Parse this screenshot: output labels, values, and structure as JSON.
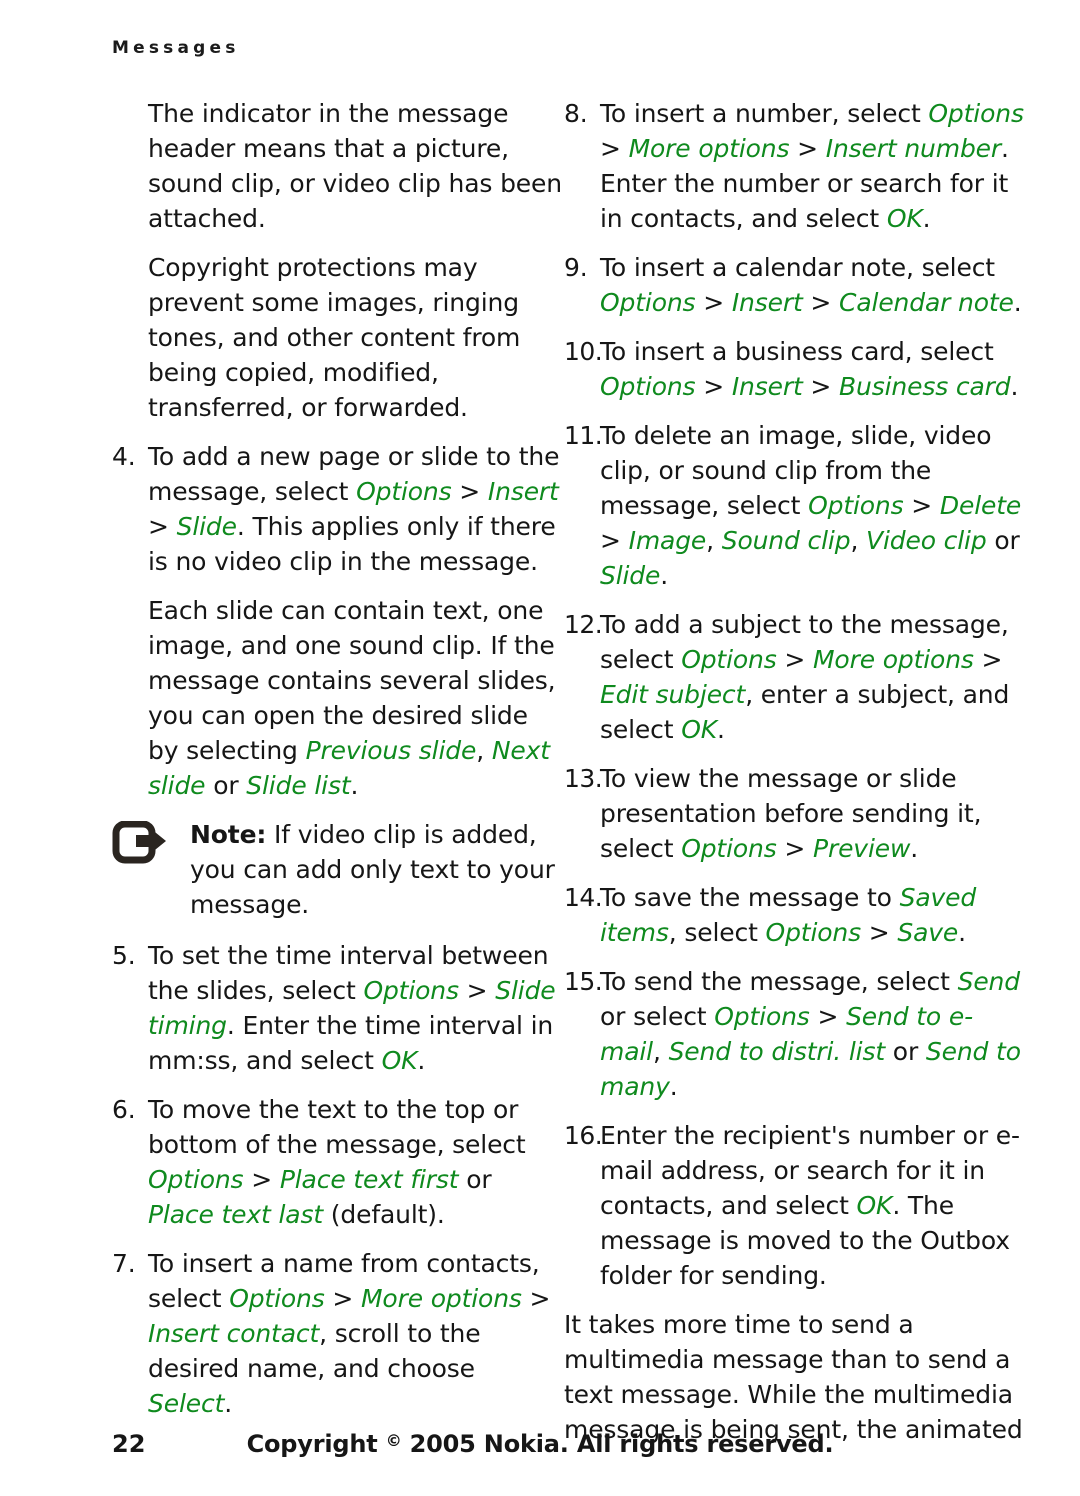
{
  "running_head": "Messages",
  "green_accent": "#0f8a1e",
  "text_color": "#161616",
  "left_column": [
    {
      "kind": "paragraph",
      "name": "paragraph-indicator",
      "runs": [
        {
          "t": "The indicator in the message header means that a picture, sound clip, or video clip has been attached.",
          "s": "plain"
        }
      ]
    },
    {
      "kind": "paragraph",
      "name": "paragraph-copyright-protections",
      "runs": [
        {
          "t": "Copyright protections may prevent some images, ringing tones, and other content from being copied, modified, transferred, or forwarded.",
          "s": "plain"
        }
      ]
    },
    {
      "kind": "item",
      "name": "step-4",
      "number": "4.",
      "runs": [
        {
          "t": "To add a new page or slide to the message, select ",
          "s": "plain"
        },
        {
          "t": "Options",
          "s": "ui"
        },
        {
          "t": " > ",
          "s": "sep"
        },
        {
          "t": "Insert",
          "s": "ui"
        },
        {
          "t": " > ",
          "s": "sep"
        },
        {
          "t": "Slide",
          "s": "ui"
        },
        {
          "t": ". This applies only if there is no video clip in the message.",
          "s": "plain"
        }
      ]
    },
    {
      "kind": "paragraph",
      "name": "paragraph-each-slide",
      "runs": [
        {
          "t": "Each slide can contain text, one image, and one sound clip. If the message contains several slides, you can open the desired slide by selecting ",
          "s": "plain"
        },
        {
          "t": "Previous slide",
          "s": "ui"
        },
        {
          "t": ", ",
          "s": "sep"
        },
        {
          "t": "Next slide",
          "s": "ui"
        },
        {
          "t": " or ",
          "s": "plain"
        },
        {
          "t": "Slide list",
          "s": "ui"
        },
        {
          "t": ".",
          "s": "plain"
        }
      ]
    },
    {
      "kind": "note",
      "name": "note-video-clip",
      "icon": "note-arrow-icon",
      "label": "Note:",
      "runs": [
        {
          "t": " If video clip is added, you can add only text to your message.",
          "s": "plain"
        }
      ]
    },
    {
      "kind": "item",
      "name": "step-5",
      "number": "5.",
      "runs": [
        {
          "t": "To set the time interval between the slides, select ",
          "s": "plain"
        },
        {
          "t": "Options",
          "s": "ui"
        },
        {
          "t": " > ",
          "s": "sep"
        },
        {
          "t": "Slide timing",
          "s": "ui"
        },
        {
          "t": ". Enter the time interval in mm:ss, and select ",
          "s": "plain"
        },
        {
          "t": "OK",
          "s": "ui"
        },
        {
          "t": ".",
          "s": "plain"
        }
      ]
    },
    {
      "kind": "item",
      "name": "step-6",
      "number": "6.",
      "runs": [
        {
          "t": "To move the text to the top or bottom of the message, select ",
          "s": "plain"
        },
        {
          "t": "Options",
          "s": "ui"
        },
        {
          "t": " > ",
          "s": "sep"
        },
        {
          "t": "Place text first",
          "s": "ui"
        },
        {
          "t": " or ",
          "s": "plain"
        },
        {
          "t": "Place text last",
          "s": "ui"
        },
        {
          "t": " (default).",
          "s": "plain"
        }
      ]
    },
    {
      "kind": "item",
      "name": "step-7",
      "number": "7.",
      "runs": [
        {
          "t": "To insert a name from contacts, select ",
          "s": "plain"
        },
        {
          "t": "Options",
          "s": "ui"
        },
        {
          "t": " > ",
          "s": "sep"
        },
        {
          "t": "More options",
          "s": "ui"
        },
        {
          "t": " > ",
          "s": "sep"
        },
        {
          "t": "Insert contact",
          "s": "ui"
        },
        {
          "t": ", scroll to the desired name, and choose ",
          "s": "plain"
        },
        {
          "t": "Select",
          "s": "ui"
        },
        {
          "t": ".",
          "s": "plain"
        }
      ]
    }
  ],
  "right_column": [
    {
      "kind": "item",
      "name": "step-8",
      "number": "8.",
      "runs": [
        {
          "t": "To insert a number, select ",
          "s": "plain"
        },
        {
          "t": "Options",
          "s": "ui"
        },
        {
          "t": " > ",
          "s": "sep"
        },
        {
          "t": "More options",
          "s": "ui"
        },
        {
          "t": " > ",
          "s": "sep"
        },
        {
          "t": "Insert number",
          "s": "ui"
        },
        {
          "t": ". Enter the number or search for it in contacts, and select ",
          "s": "plain"
        },
        {
          "t": "OK",
          "s": "ui"
        },
        {
          "t": ".",
          "s": "plain"
        }
      ]
    },
    {
      "kind": "item",
      "name": "step-9",
      "number": "9.",
      "runs": [
        {
          "t": "To insert a calendar note, select ",
          "s": "plain"
        },
        {
          "t": "Options",
          "s": "ui"
        },
        {
          "t": " > ",
          "s": "sep"
        },
        {
          "t": "Insert",
          "s": "ui"
        },
        {
          "t": " > ",
          "s": "sep"
        },
        {
          "t": "Calendar note",
          "s": "ui"
        },
        {
          "t": ".",
          "s": "plain"
        }
      ]
    },
    {
      "kind": "item",
      "name": "step-10",
      "number": "10.",
      "wide": true,
      "runs": [
        {
          "t": "To insert a business card, select ",
          "s": "plain"
        },
        {
          "t": "Options",
          "s": "ui"
        },
        {
          "t": " > ",
          "s": "sep"
        },
        {
          "t": "Insert",
          "s": "ui"
        },
        {
          "t": " > ",
          "s": "sep"
        },
        {
          "t": "Business card",
          "s": "ui"
        },
        {
          "t": ".",
          "s": "plain"
        }
      ]
    },
    {
      "kind": "item",
      "name": "step-11",
      "number": "11.",
      "wide": true,
      "runs": [
        {
          "t": "To delete an image, slide, video clip, or sound clip from the message, select ",
          "s": "plain"
        },
        {
          "t": "Options",
          "s": "ui"
        },
        {
          "t": " > ",
          "s": "sep"
        },
        {
          "t": "Delete",
          "s": "ui"
        },
        {
          "t": " > ",
          "s": "sep"
        },
        {
          "t": "Image",
          "s": "ui"
        },
        {
          "t": ", ",
          "s": "sep"
        },
        {
          "t": "Sound clip",
          "s": "ui"
        },
        {
          "t": ", ",
          "s": "sep"
        },
        {
          "t": "Video clip",
          "s": "ui"
        },
        {
          "t": " or ",
          "s": "plain"
        },
        {
          "t": "Slide",
          "s": "ui"
        },
        {
          "t": ".",
          "s": "plain"
        }
      ]
    },
    {
      "kind": "item",
      "name": "step-12",
      "number": "12.",
      "wide": true,
      "runs": [
        {
          "t": "To add a subject to the message, select ",
          "s": "plain"
        },
        {
          "t": "Options",
          "s": "ui"
        },
        {
          "t": " > ",
          "s": "sep"
        },
        {
          "t": "More options",
          "s": "ui"
        },
        {
          "t": " > ",
          "s": "sep"
        },
        {
          "t": "Edit subject",
          "s": "ui"
        },
        {
          "t": ", enter a subject, and select ",
          "s": "plain"
        },
        {
          "t": "OK",
          "s": "ui"
        },
        {
          "t": ".",
          "s": "plain"
        }
      ]
    },
    {
      "kind": "item",
      "name": "step-13",
      "number": "13.",
      "wide": true,
      "runs": [
        {
          "t": "To view the message or slide presentation before sending it, select ",
          "s": "plain"
        },
        {
          "t": "Options",
          "s": "ui"
        },
        {
          "t": " > ",
          "s": "sep"
        },
        {
          "t": "Preview",
          "s": "ui"
        },
        {
          "t": ".",
          "s": "plain"
        }
      ]
    },
    {
      "kind": "item",
      "name": "step-14",
      "number": "14.",
      "wide": true,
      "runs": [
        {
          "t": "To save the message to ",
          "s": "plain"
        },
        {
          "t": "Saved items",
          "s": "ui"
        },
        {
          "t": ", select ",
          "s": "plain"
        },
        {
          "t": "Options",
          "s": "ui"
        },
        {
          "t": " > ",
          "s": "sep"
        },
        {
          "t": "Save",
          "s": "ui"
        },
        {
          "t": ".",
          "s": "plain"
        }
      ]
    },
    {
      "kind": "item",
      "name": "step-15",
      "number": "15.",
      "wide": true,
      "runs": [
        {
          "t": "To send the message, select ",
          "s": "plain"
        },
        {
          "t": "Send",
          "s": "ui"
        },
        {
          "t": " or select ",
          "s": "plain"
        },
        {
          "t": "Options",
          "s": "ui"
        },
        {
          "t": " > ",
          "s": "sep"
        },
        {
          "t": "Send to e-mail",
          "s": "ui"
        },
        {
          "t": ", ",
          "s": "sep"
        },
        {
          "t": "Send to distri. list",
          "s": "ui"
        },
        {
          "t": " or ",
          "s": "plain"
        },
        {
          "t": "Send to many",
          "s": "ui"
        },
        {
          "t": ".",
          "s": "plain"
        }
      ]
    },
    {
      "kind": "item",
      "name": "step-16",
      "number": "16.",
      "wide": true,
      "runs": [
        {
          "t": "Enter the recipient's number or e-mail address, or search for it in contacts, and select ",
          "s": "plain"
        },
        {
          "t": "OK",
          "s": "ui"
        },
        {
          "t": ". The message is moved to the Outbox folder for sending.",
          "s": "plain"
        }
      ]
    },
    {
      "kind": "paragraph",
      "name": "paragraph-takes-more-time",
      "runs": [
        {
          "t": "It takes more time to send a multimedia message than to send a text message. While the multimedia message is being sent, the animated",
          "s": "plain"
        }
      ]
    }
  ],
  "footer": {
    "page_number": "22",
    "copyright_prefix": "Copyright ",
    "copyright_symbol": "©",
    "copyright_suffix": " 2005 Nokia. All rights reserved."
  }
}
